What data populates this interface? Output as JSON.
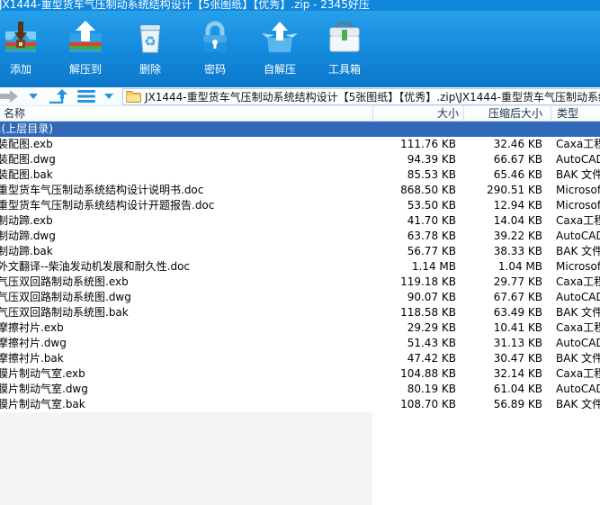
{
  "window": {
    "title": "JX1444-重型货车气压制动系统结构设计【5张图纸】【优秀】.zip - 2345好压",
    "app_name": "2345好压"
  },
  "toolbar": {
    "buttons": [
      {
        "id": "add",
        "label": "添加",
        "icon": "add-archive-icon"
      },
      {
        "id": "extract",
        "label": "解压到",
        "icon": "extract-to-icon"
      },
      {
        "id": "delete",
        "label": "删除",
        "icon": "recycle-bin-icon"
      },
      {
        "id": "password",
        "label": "密码",
        "icon": "lock-icon"
      },
      {
        "id": "sfx",
        "label": "自解压",
        "icon": "self-extract-box-icon"
      },
      {
        "id": "toolbox",
        "label": "工具箱",
        "icon": "toolbox-icon"
      }
    ]
  },
  "navbar": {
    "icons": [
      "back-arrow-icon",
      "forward-arrow-icon",
      "chevron-down-icon",
      "folder-up-icon",
      "list-view-icon",
      "chevron-down-icon"
    ],
    "address": {
      "folder_icon": "folder-icon",
      "path": "JX1444-重型货车气压制动系统结构设计【5张图纸】【优秀】.zip\\JX1444-重型货车气压制动系统"
    }
  },
  "file_list": {
    "columns": [
      {
        "id": "name",
        "label": "名称"
      },
      {
        "id": "size",
        "label": "大小"
      },
      {
        "id": "packed",
        "label": "压缩后大小"
      },
      {
        "id": "type",
        "label": "类型"
      }
    ],
    "rows": [
      {
        "name": "..(上层目录)",
        "size": "",
        "packed": "",
        "type": "",
        "selected": true
      },
      {
        "name": "装配图.exb",
        "size": "111.76 KB",
        "packed": "32.46 KB",
        "type": "Caxa工程",
        "selected": false
      },
      {
        "name": "装配图.dwg",
        "size": "94.39 KB",
        "packed": "66.67 KB",
        "type": "AutoCAD",
        "selected": false
      },
      {
        "name": "装配图.bak",
        "size": "85.53 KB",
        "packed": "65.46 KB",
        "type": "BAK 文件",
        "selected": false
      },
      {
        "name": "重型货车气压制动系统结构设计说明书.doc",
        "size": "868.50 KB",
        "packed": "290.51 KB",
        "type": "Microsof",
        "selected": false
      },
      {
        "name": "重型货车气压制动系统结构设计开题报告.doc",
        "size": "53.50 KB",
        "packed": "12.94 KB",
        "type": "Microsof",
        "selected": false
      },
      {
        "name": "制动蹄.exb",
        "size": "41.70 KB",
        "packed": "14.04 KB",
        "type": "Caxa工程",
        "selected": false
      },
      {
        "name": "制动蹄.dwg",
        "size": "63.78 KB",
        "packed": "39.22 KB",
        "type": "AutoCAD",
        "selected": false
      },
      {
        "name": "制动蹄.bak",
        "size": "56.77 KB",
        "packed": "38.33 KB",
        "type": "BAK 文件",
        "selected": false
      },
      {
        "name": "外文翻译--柴油发动机发展和耐久性.doc",
        "size": "1.14 MB",
        "packed": "1.04 MB",
        "type": "Microsof",
        "selected": false
      },
      {
        "name": "气压双回路制动系统图.exb",
        "size": "119.18 KB",
        "packed": "29.77 KB",
        "type": "Caxa工程",
        "selected": false
      },
      {
        "name": "气压双回路制动系统图.dwg",
        "size": "90.07 KB",
        "packed": "67.67 KB",
        "type": "AutoCAD",
        "selected": false
      },
      {
        "name": "气压双回路制动系统图.bak",
        "size": "118.58 KB",
        "packed": "63.49 KB",
        "type": "BAK 文件",
        "selected": false
      },
      {
        "name": "摩擦衬片.exb",
        "size": "29.29 KB",
        "packed": "10.41 KB",
        "type": "Caxa工程",
        "selected": false
      },
      {
        "name": "摩擦衬片.dwg",
        "size": "51.43 KB",
        "packed": "31.13 KB",
        "type": "AutoCAD",
        "selected": false
      },
      {
        "name": "摩擦衬片.bak",
        "size": "47.42 KB",
        "packed": "30.47 KB",
        "type": "BAK 文件",
        "selected": false
      },
      {
        "name": "膜片制动气室.exb",
        "size": "104.88 KB",
        "packed": "32.14 KB",
        "type": "Caxa工程",
        "selected": false
      },
      {
        "name": "膜片制动气室.dwg",
        "size": "80.19 KB",
        "packed": "61.04 KB",
        "type": "AutoCAD",
        "selected": false
      },
      {
        "name": "膜片制动气室.bak",
        "size": "108.70 KB",
        "packed": "56.89 KB",
        "type": "BAK 文件",
        "selected": false
      }
    ]
  },
  "colors": {
    "titlebar": "#1187dc",
    "toolbar_top": "#27a0ea",
    "toolbar_bottom": "#0d78cb",
    "selected_row": "#2f69b8",
    "header_divider": "#cadff0",
    "sorted_column_tint": "#f4f4f6",
    "address_border": "#a9cce8",
    "folder_yellow": "#f0c64a"
  }
}
